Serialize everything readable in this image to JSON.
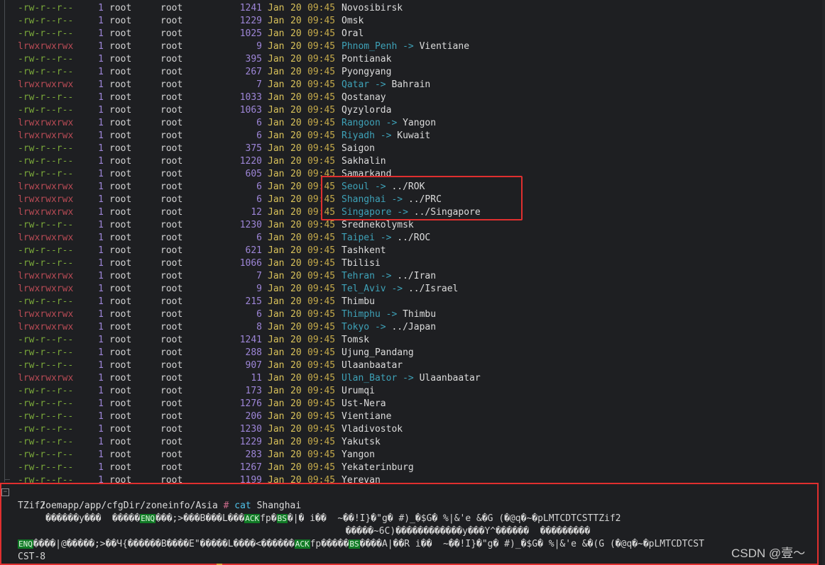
{
  "listing": [
    {
      "perm": "-rw-r--r--",
      "type": "file",
      "links": "1",
      "owner": "root",
      "group": "root",
      "size": "1241",
      "month": "Jan",
      "day": "20",
      "time": "09:45",
      "name": "Novosibirsk"
    },
    {
      "perm": "-rw-r--r--",
      "type": "file",
      "links": "1",
      "owner": "root",
      "group": "root",
      "size": "1229",
      "month": "Jan",
      "day": "20",
      "time": "09:45",
      "name": "Omsk"
    },
    {
      "perm": "-rw-r--r--",
      "type": "file",
      "links": "1",
      "owner": "root",
      "group": "root",
      "size": "1025",
      "month": "Jan",
      "day": "20",
      "time": "09:45",
      "name": "Oral"
    },
    {
      "perm": "lrwxrwxrwx",
      "type": "link",
      "links": "1",
      "owner": "root",
      "group": "root",
      "size": "9",
      "month": "Jan",
      "day": "20",
      "time": "09:45",
      "name": "Phnom_Penh",
      "target": "Vientiane"
    },
    {
      "perm": "-rw-r--r--",
      "type": "file",
      "links": "1",
      "owner": "root",
      "group": "root",
      "size": "395",
      "month": "Jan",
      "day": "20",
      "time": "09:45",
      "name": "Pontianak"
    },
    {
      "perm": "-rw-r--r--",
      "type": "file",
      "links": "1",
      "owner": "root",
      "group": "root",
      "size": "267",
      "month": "Jan",
      "day": "20",
      "time": "09:45",
      "name": "Pyongyang"
    },
    {
      "perm": "lrwxrwxrwx",
      "type": "link",
      "links": "1",
      "owner": "root",
      "group": "root",
      "size": "7",
      "month": "Jan",
      "day": "20",
      "time": "09:45",
      "name": "Qatar",
      "target": "Bahrain"
    },
    {
      "perm": "-rw-r--r--",
      "type": "file",
      "links": "1",
      "owner": "root",
      "group": "root",
      "size": "1033",
      "month": "Jan",
      "day": "20",
      "time": "09:45",
      "name": "Qostanay"
    },
    {
      "perm": "-rw-r--r--",
      "type": "file",
      "links": "1",
      "owner": "root",
      "group": "root",
      "size": "1063",
      "month": "Jan",
      "day": "20",
      "time": "09:45",
      "name": "Qyzylorda"
    },
    {
      "perm": "lrwxrwxrwx",
      "type": "link",
      "links": "1",
      "owner": "root",
      "group": "root",
      "size": "6",
      "month": "Jan",
      "day": "20",
      "time": "09:45",
      "name": "Rangoon",
      "target": "Yangon"
    },
    {
      "perm": "lrwxrwxrwx",
      "type": "link",
      "links": "1",
      "owner": "root",
      "group": "root",
      "size": "6",
      "month": "Jan",
      "day": "20",
      "time": "09:45",
      "name": "Riyadh",
      "target": "Kuwait"
    },
    {
      "perm": "-rw-r--r--",
      "type": "file",
      "links": "1",
      "owner": "root",
      "group": "root",
      "size": "375",
      "month": "Jan",
      "day": "20",
      "time": "09:45",
      "name": "Saigon"
    },
    {
      "perm": "-rw-r--r--",
      "type": "file",
      "links": "1",
      "owner": "root",
      "group": "root",
      "size": "1220",
      "month": "Jan",
      "day": "20",
      "time": "09:45",
      "name": "Sakhalin"
    },
    {
      "perm": "-rw-r--r--",
      "type": "file",
      "links": "1",
      "owner": "root",
      "group": "root",
      "size": "605",
      "month": "Jan",
      "day": "20",
      "time": "09:45",
      "name": "Samarkand"
    },
    {
      "perm": "lrwxrwxrwx",
      "type": "link",
      "links": "1",
      "owner": "root",
      "group": "root",
      "size": "6",
      "month": "Jan",
      "day": "20",
      "time": "09:45",
      "name": "Seoul",
      "target": "../ROK"
    },
    {
      "perm": "lrwxrwxrwx",
      "type": "link",
      "links": "1",
      "owner": "root",
      "group": "root",
      "size": "6",
      "month": "Jan",
      "day": "20",
      "time": "09:45",
      "name": "Shanghai",
      "target": "../PRC"
    },
    {
      "perm": "lrwxrwxrwx",
      "type": "link",
      "links": "1",
      "owner": "root",
      "group": "root",
      "size": "12",
      "month": "Jan",
      "day": "20",
      "time": "09:45",
      "name": "Singapore",
      "target": "../Singapore"
    },
    {
      "perm": "-rw-r--r--",
      "type": "file",
      "links": "1",
      "owner": "root",
      "group": "root",
      "size": "1230",
      "month": "Jan",
      "day": "20",
      "time": "09:45",
      "name": "Srednekolymsk"
    },
    {
      "perm": "lrwxrwxrwx",
      "type": "link",
      "links": "1",
      "owner": "root",
      "group": "root",
      "size": "6",
      "month": "Jan",
      "day": "20",
      "time": "09:45",
      "name": "Taipei",
      "target": "../ROC"
    },
    {
      "perm": "-rw-r--r--",
      "type": "file",
      "links": "1",
      "owner": "root",
      "group": "root",
      "size": "621",
      "month": "Jan",
      "day": "20",
      "time": "09:45",
      "name": "Tashkent"
    },
    {
      "perm": "-rw-r--r--",
      "type": "file",
      "links": "1",
      "owner": "root",
      "group": "root",
      "size": "1066",
      "month": "Jan",
      "day": "20",
      "time": "09:45",
      "name": "Tbilisi"
    },
    {
      "perm": "lrwxrwxrwx",
      "type": "link",
      "links": "1",
      "owner": "root",
      "group": "root",
      "size": "7",
      "month": "Jan",
      "day": "20",
      "time": "09:45",
      "name": "Tehran",
      "target": "../Iran"
    },
    {
      "perm": "lrwxrwxrwx",
      "type": "link",
      "links": "1",
      "owner": "root",
      "group": "root",
      "size": "9",
      "month": "Jan",
      "day": "20",
      "time": "09:45",
      "name": "Tel_Aviv",
      "target": "../Israel"
    },
    {
      "perm": "-rw-r--r--",
      "type": "file",
      "links": "1",
      "owner": "root",
      "group": "root",
      "size": "215",
      "month": "Jan",
      "day": "20",
      "time": "09:45",
      "name": "Thimbu"
    },
    {
      "perm": "lrwxrwxrwx",
      "type": "link",
      "links": "1",
      "owner": "root",
      "group": "root",
      "size": "6",
      "month": "Jan",
      "day": "20",
      "time": "09:45",
      "name": "Thimphu",
      "target": "Thimbu"
    },
    {
      "perm": "lrwxrwxrwx",
      "type": "link",
      "links": "1",
      "owner": "root",
      "group": "root",
      "size": "8",
      "month": "Jan",
      "day": "20",
      "time": "09:45",
      "name": "Tokyo",
      "target": "../Japan"
    },
    {
      "perm": "-rw-r--r--",
      "type": "file",
      "links": "1",
      "owner": "root",
      "group": "root",
      "size": "1241",
      "month": "Jan",
      "day": "20",
      "time": "09:45",
      "name": "Tomsk"
    },
    {
      "perm": "-rw-r--r--",
      "type": "file",
      "links": "1",
      "owner": "root",
      "group": "root",
      "size": "288",
      "month": "Jan",
      "day": "20",
      "time": "09:45",
      "name": "Ujung_Pandang"
    },
    {
      "perm": "-rw-r--r--",
      "type": "file",
      "links": "1",
      "owner": "root",
      "group": "root",
      "size": "907",
      "month": "Jan",
      "day": "20",
      "time": "09:45",
      "name": "Ulaanbaatar"
    },
    {
      "perm": "lrwxrwxrwx",
      "type": "link",
      "links": "1",
      "owner": "root",
      "group": "root",
      "size": "11",
      "month": "Jan",
      "day": "20",
      "time": "09:45",
      "name": "Ulan_Bator",
      "target": "Ulaanbaatar"
    },
    {
      "perm": "-rw-r--r--",
      "type": "file",
      "links": "1",
      "owner": "root",
      "group": "root",
      "size": "173",
      "month": "Jan",
      "day": "20",
      "time": "09:45",
      "name": "Urumqi"
    },
    {
      "perm": "-rw-r--r--",
      "type": "file",
      "links": "1",
      "owner": "root",
      "group": "root",
      "size": "1276",
      "month": "Jan",
      "day": "20",
      "time": "09:45",
      "name": "Ust-Nera"
    },
    {
      "perm": "-rw-r--r--",
      "type": "file",
      "links": "1",
      "owner": "root",
      "group": "root",
      "size": "206",
      "month": "Jan",
      "day": "20",
      "time": "09:45",
      "name": "Vientiane"
    },
    {
      "perm": "-rw-r--r--",
      "type": "file",
      "links": "1",
      "owner": "root",
      "group": "root",
      "size": "1230",
      "month": "Jan",
      "day": "20",
      "time": "09:45",
      "name": "Vladivostok"
    },
    {
      "perm": "-rw-r--r--",
      "type": "file",
      "links": "1",
      "owner": "root",
      "group": "root",
      "size": "1229",
      "month": "Jan",
      "day": "20",
      "time": "09:45",
      "name": "Yakutsk"
    },
    {
      "perm": "-rw-r--r--",
      "type": "file",
      "links": "1",
      "owner": "root",
      "group": "root",
      "size": "283",
      "month": "Jan",
      "day": "20",
      "time": "09:45",
      "name": "Yangon"
    },
    {
      "perm": "-rw-r--r--",
      "type": "file",
      "links": "1",
      "owner": "root",
      "group": "root",
      "size": "1267",
      "month": "Jan",
      "day": "20",
      "time": "09:45",
      "name": "Yekaterinburg"
    },
    {
      "perm": "-rw-r--r--",
      "type": "file",
      "links": "1",
      "owner": "root",
      "group": "root",
      "size": "1199",
      "month": "Jan",
      "day": "20",
      "time": "09:45",
      "name": "Yerevan"
    }
  ],
  "link_arrow": "->",
  "prompt": {
    "path": "/oemapp/app/cfgDir/zoneinfo/Asia",
    "symbol": "#",
    "command": "cat",
    "argument": "Shanghai"
  },
  "cat_output": {
    "line1": "TZif2",
    "line2_a": "     ������y���  �����",
    "tag_enq": "ENQ",
    "line2_b": "���;>���B���L���",
    "tag_ack": "ACK",
    "line2_c": "fp�",
    "tag_bs": "BS",
    "line2_d": "�|� i��  ~��!I}�\"g� #)_�$G� %|&'e &�G (�@q�~�pLMTCDTCSTTZif2",
    "line3": "                                                           �����~6C)������������y���Y^������  ���������  ",
    "line4_a": "",
    "tag_enq2": "ENQ",
    "line4_b": "����|@�����;>��Ч{������B����E\"�����L����<������",
    "tag_ack2": "ACK",
    "line4_c": "fp�����",
    "tag_bs2": "BS",
    "line4_d": "����A|��R i��  ~��!I}�\"g� #)_�$G� %|&'e &�(G (�@q�~�pLMTCDTCST",
    "line5": "CST-8"
  },
  "watermark": "CSDN @壹～",
  "colors": {
    "background": "#1e1f22",
    "highlight_box": "#e02f2f",
    "link_name": "#3ea2b8",
    "date": "#d8c15a",
    "count": "#9e86d8"
  }
}
